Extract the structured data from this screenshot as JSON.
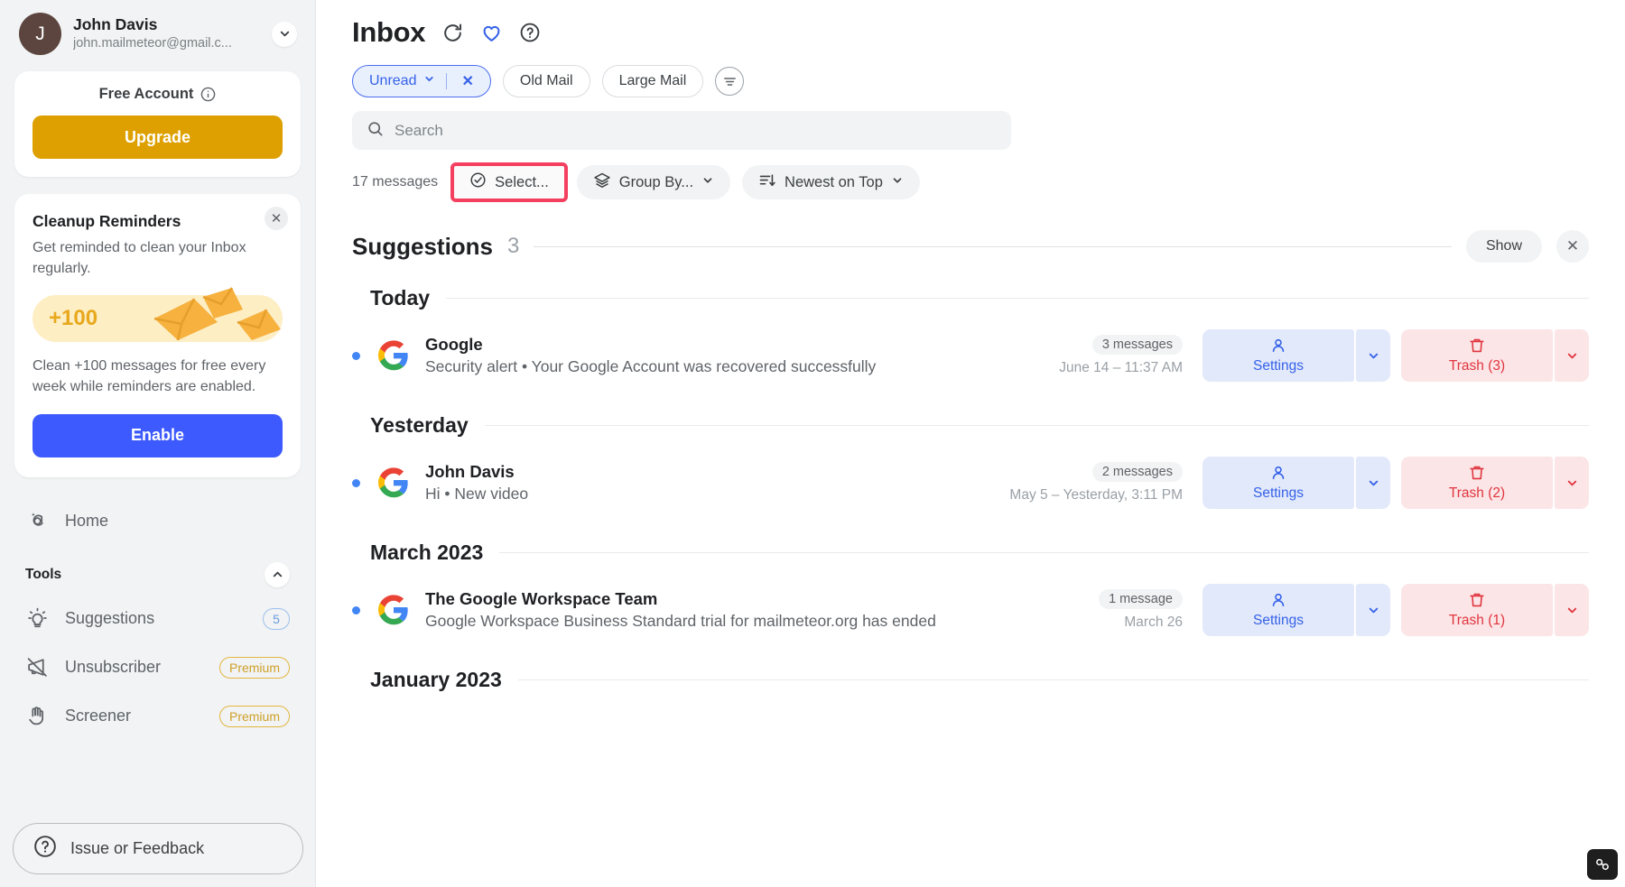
{
  "sidebar": {
    "account": {
      "initial": "J",
      "name": "John Davis",
      "email": "john.mailmeteor@gmail.c...",
      "chevron_icon": "chevron-down-icon"
    },
    "free_card": {
      "title": "Free Account",
      "info_icon": "info-icon",
      "upgrade_label": "Upgrade"
    },
    "cleanup_card": {
      "title": "Cleanup Reminders",
      "subtitle": "Get reminded to clean your Inbox regularly.",
      "promo_badge": "+100",
      "description": "Clean +100 messages for free every week while reminders are enabled.",
      "enable_label": "Enable",
      "close_icon": "close-icon"
    },
    "nav": [
      {
        "label": "Home",
        "icon": "at-sparkle-icon",
        "badge": null,
        "badge_type": null
      }
    ],
    "tools_section": {
      "title": "Tools",
      "collapse_icon": "chevron-up-icon",
      "items": [
        {
          "label": "Suggestions",
          "icon": "lightbulb-icon",
          "badge": "5",
          "badge_type": "count"
        },
        {
          "label": "Unsubscriber",
          "icon": "megaphone-off-icon",
          "badge": "Premium",
          "badge_type": "premium"
        },
        {
          "label": "Screener",
          "icon": "hand-icon",
          "badge": "Premium",
          "badge_type": "premium"
        }
      ]
    },
    "feedback": {
      "label": "Issue or Feedback",
      "icon": "question-circle-icon"
    }
  },
  "header": {
    "title": "Inbox",
    "icons": [
      {
        "name": "refresh-icon"
      },
      {
        "name": "heart-icon"
      },
      {
        "name": "help-circle-icon"
      }
    ]
  },
  "filters": {
    "chips": [
      {
        "label": "Unread",
        "active": true,
        "has_caret": true,
        "has_clear": true
      },
      {
        "label": "Old Mail",
        "active": false
      },
      {
        "label": "Large Mail",
        "active": false
      }
    ],
    "filter_icon": "filter-list-icon"
  },
  "search": {
    "placeholder": "Search",
    "value": "",
    "icon": "search-icon"
  },
  "toolbar": {
    "message_count": "17 messages",
    "select_label": "Select...",
    "select_icon": "check-circle-icon",
    "group_by_label": "Group By...",
    "group_by_icon": "layers-icon",
    "sort_label": "Newest on Top",
    "sort_icon": "sort-desc-icon",
    "caret_icon": "chevron-down-icon"
  },
  "suggestions": {
    "title": "Suggestions",
    "count": "3",
    "show_label": "Show",
    "close_icon": "close-icon"
  },
  "groups": [
    {
      "date_label": "Today",
      "messages": [
        {
          "sender": "Google",
          "snippet": "Security alert • Your Google Account was recovered successfully",
          "count_pill": "3 messages",
          "date": "June 14 – 11:37 AM",
          "settings_label": "Settings",
          "settings_icon": "user-icon",
          "trash_label": "Trash (3)",
          "trash_icon": "trash-icon",
          "avatar_icon": "google-logo"
        }
      ]
    },
    {
      "date_label": "Yesterday",
      "messages": [
        {
          "sender": "John Davis",
          "snippet": "Hi • New video",
          "count_pill": "2 messages",
          "date": "May 5 – Yesterday, 3:11 PM",
          "settings_label": "Settings",
          "settings_icon": "user-icon",
          "trash_label": "Trash (2)",
          "trash_icon": "trash-icon",
          "avatar_icon": "google-logo"
        }
      ]
    },
    {
      "date_label": "March 2023",
      "messages": [
        {
          "sender": "The Google Workspace Team",
          "snippet": "Google Workspace Business Standard trial for mailmeteor.org has ended",
          "count_pill": "1 message",
          "date": "March 26",
          "settings_label": "Settings",
          "settings_icon": "user-icon",
          "trash_label": "Trash (1)",
          "trash_icon": "trash-icon",
          "avatar_icon": "google-logo"
        }
      ]
    },
    {
      "date_label": "January 2023",
      "messages": []
    }
  ],
  "colors": {
    "accent_blue": "#3562e8",
    "upgrade_gold": "#dda000",
    "enable_blue": "#3d5afe",
    "trash_red": "#e0353f",
    "highlight_pink": "#f43f5e",
    "premium_gold": "#cfa028"
  }
}
